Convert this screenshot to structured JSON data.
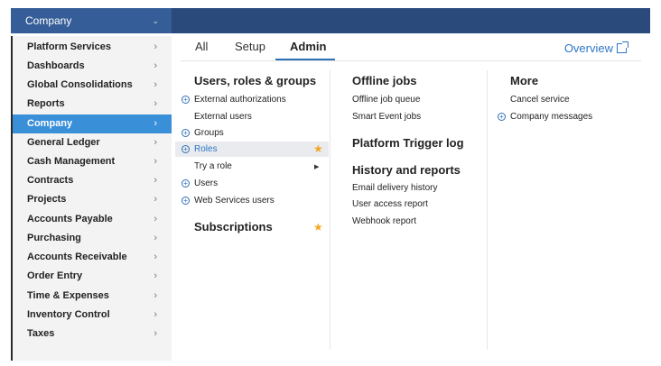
{
  "topbar": {
    "company_selector": "Company"
  },
  "sidebar": {
    "items": [
      {
        "label": "Platform Services"
      },
      {
        "label": "Dashboards"
      },
      {
        "label": "Global Consolidations"
      },
      {
        "label": "Reports"
      },
      {
        "label": "Company"
      },
      {
        "label": "General Ledger"
      },
      {
        "label": "Cash Management"
      },
      {
        "label": "Contracts"
      },
      {
        "label": "Projects"
      },
      {
        "label": "Accounts Payable"
      },
      {
        "label": "Purchasing"
      },
      {
        "label": "Accounts Receivable"
      },
      {
        "label": "Order Entry"
      },
      {
        "label": "Time & Expenses"
      },
      {
        "label": "Inventory Control"
      },
      {
        "label": "Taxes"
      }
    ],
    "arrow": "›"
  },
  "tabs": [
    {
      "label": "All"
    },
    {
      "label": "Setup"
    },
    {
      "label": "Admin"
    }
  ],
  "overview_label": "Overview",
  "col1": {
    "heading": "Users, roles & groups",
    "links": [
      {
        "label": "External authorizations"
      },
      {
        "label": "External users"
      },
      {
        "label": "Groups"
      },
      {
        "label": "Roles"
      },
      {
        "label": "Try a role"
      },
      {
        "label": "Users"
      },
      {
        "label": "Web Services users"
      }
    ],
    "subscriptions_heading": "Subscriptions"
  },
  "col2": {
    "heading": "Offline jobs",
    "links": [
      {
        "label": "Offline job queue"
      },
      {
        "label": "Smart Event jobs"
      }
    ],
    "trigger_heading": "Platform Trigger log",
    "history_heading": "History and reports",
    "history_links": [
      {
        "label": "Email delivery history"
      },
      {
        "label": "User access report"
      },
      {
        "label": "Webhook report"
      }
    ]
  },
  "col3": {
    "heading": "More",
    "links": [
      {
        "label": "Cancel service"
      },
      {
        "label": "Company messages"
      }
    ]
  },
  "colors": {
    "topbar": "#2a4a7b",
    "active_sidebar": "#3a8fd9",
    "link_accent": "#2e77c8",
    "star": "#f5a623"
  }
}
